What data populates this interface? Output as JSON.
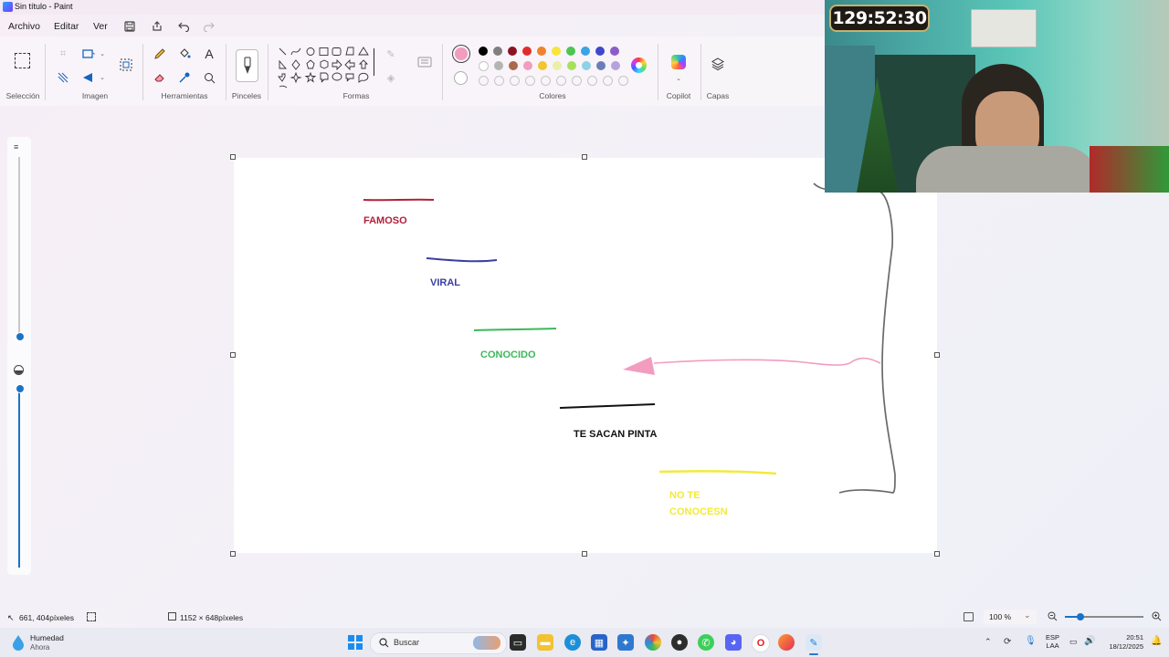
{
  "window": {
    "title": "Sin título - Paint"
  },
  "menu": {
    "file": "Archivo",
    "edit": "Editar",
    "view": "Ver"
  },
  "ribbon": {
    "groups": {
      "selection": "Selección",
      "image": "Imagen",
      "tools": "Herramientas",
      "brushes": "Pinceles",
      "shapes": "Formas",
      "colors": "Colores",
      "copilot": "Copilot",
      "layers": "Capas"
    },
    "text_tool_glyph": "A",
    "selected_color": "#f29cc0",
    "palette_row1": [
      "#000000",
      "#7f7f7f",
      "#8a1323",
      "#e32b2b",
      "#f0812e",
      "#f7e53b",
      "#4cc650",
      "#3aa4e6",
      "#3f48cc",
      "#8b5ec6"
    ],
    "palette_row2": [
      "#ffffff",
      "#b4b4b4",
      "#a86a4a",
      "#f29cc0",
      "#f1c531",
      "#e8f0a5",
      "#a6e05c",
      "#8fd1e6",
      "#6a7fb8",
      "#b6a2dd"
    ]
  },
  "canvas": {
    "labels": {
      "famous": "FAMOSO",
      "viral": "VIRAL",
      "known": "CONOCIDO",
      "paint_out": "TE SACAN PINTA",
      "unknown_line1": "NO TE",
      "unknown_line2": "CONOCESN"
    },
    "colors": {
      "famous": "#b1203b",
      "viral": "#3c3ea0",
      "known": "#3cb85a",
      "paint_out": "#111111",
      "unknown": "#f2ea3a",
      "arrow": "#f29cc0",
      "bracket": "#6a6a6a"
    }
  },
  "statusbar": {
    "cursor_position": "661, 404píxeles",
    "canvas_size": "1152 × 648píxeles",
    "zoom": "100 %",
    "zoom_level_fraction": 0.2
  },
  "taskbar": {
    "weather_title": "Humedad",
    "weather_sub": "Ahora",
    "search_placeholder": "Buscar",
    "lang_top": "ESP",
    "lang_bottom": "LAA",
    "time": "20:51",
    "date": "18/12/2025"
  },
  "overlay": {
    "timer": "129:52:30"
  }
}
